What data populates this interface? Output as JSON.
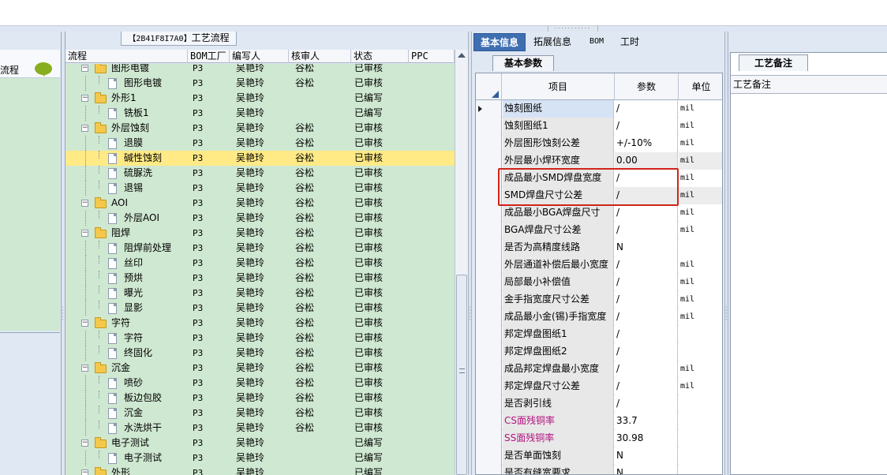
{
  "left_panel": {
    "header_label": "流程"
  },
  "process": {
    "title_code": "【2B41F8I7A0】",
    "title_text": "工艺流程",
    "columns": [
      "流程",
      "BOM工厂",
      "编写人",
      "核审人",
      "状态",
      "PPC"
    ],
    "rows": [
      {
        "name": "图形电镀",
        "level": 1,
        "bom": "P3",
        "writer": "吴艳玲",
        "reviewer": "谷松",
        "status": "已审核",
        "selected": false
      },
      {
        "name": "图形电镀",
        "level": 2,
        "bom": "P3",
        "writer": "吴艳玲",
        "reviewer": "谷松",
        "status": "已审核",
        "selected": false
      },
      {
        "name": "外形1",
        "level": 1,
        "bom": "P3",
        "writer": "吴艳玲",
        "reviewer": "",
        "status": "已编写",
        "selected": false
      },
      {
        "name": "铣板1",
        "level": 2,
        "bom": "P3",
        "writer": "吴艳玲",
        "reviewer": "",
        "status": "已编写",
        "selected": false
      },
      {
        "name": "外层蚀刻",
        "level": 1,
        "bom": "P3",
        "writer": "吴艳玲",
        "reviewer": "谷松",
        "status": "已审核",
        "selected": false
      },
      {
        "name": "退膜",
        "level": 2,
        "bom": "P3",
        "writer": "吴艳玲",
        "reviewer": "谷松",
        "status": "已审核",
        "selected": false
      },
      {
        "name": "碱性蚀刻",
        "level": 2,
        "bom": "P3",
        "writer": "吴艳玲",
        "reviewer": "谷松",
        "status": "已审核",
        "selected": true
      },
      {
        "name": "硫脲洗",
        "level": 2,
        "bom": "P3",
        "writer": "吴艳玲",
        "reviewer": "谷松",
        "status": "已审核",
        "selected": false
      },
      {
        "name": "退锡",
        "level": 2,
        "bom": "P3",
        "writer": "吴艳玲",
        "reviewer": "谷松",
        "status": "已审核",
        "selected": false
      },
      {
        "name": "AOI",
        "level": 1,
        "bom": "P3",
        "writer": "吴艳玲",
        "reviewer": "谷松",
        "status": "已审核",
        "selected": false
      },
      {
        "name": "外层AOI",
        "level": 2,
        "bom": "P3",
        "writer": "吴艳玲",
        "reviewer": "谷松",
        "status": "已审核",
        "selected": false
      },
      {
        "name": "阻焊",
        "level": 1,
        "bom": "P3",
        "writer": "吴艳玲",
        "reviewer": "谷松",
        "status": "已审核",
        "selected": false
      },
      {
        "name": "阻焊前处理",
        "level": 2,
        "bom": "P3",
        "writer": "吴艳玲",
        "reviewer": "谷松",
        "status": "已审核",
        "selected": false
      },
      {
        "name": "丝印",
        "level": 2,
        "bom": "P3",
        "writer": "吴艳玲",
        "reviewer": "谷松",
        "status": "已审核",
        "selected": false
      },
      {
        "name": "预烘",
        "level": 2,
        "bom": "P3",
        "writer": "吴艳玲",
        "reviewer": "谷松",
        "status": "已审核",
        "selected": false
      },
      {
        "name": "曝光",
        "level": 2,
        "bom": "P3",
        "writer": "吴艳玲",
        "reviewer": "谷松",
        "status": "已审核",
        "selected": false
      },
      {
        "name": "显影",
        "level": 2,
        "bom": "P3",
        "writer": "吴艳玲",
        "reviewer": "谷松",
        "status": "已审核",
        "selected": false
      },
      {
        "name": "字符",
        "level": 1,
        "bom": "P3",
        "writer": "吴艳玲",
        "reviewer": "谷松",
        "status": "已审核",
        "selected": false
      },
      {
        "name": "字符",
        "level": 2,
        "bom": "P3",
        "writer": "吴艳玲",
        "reviewer": "谷松",
        "status": "已审核",
        "selected": false
      },
      {
        "name": "终固化",
        "level": 2,
        "bom": "P3",
        "writer": "吴艳玲",
        "reviewer": "谷松",
        "status": "已审核",
        "selected": false
      },
      {
        "name": "沉金",
        "level": 1,
        "bom": "P3",
        "writer": "吴艳玲",
        "reviewer": "谷松",
        "status": "已审核",
        "selected": false
      },
      {
        "name": "喷砂",
        "level": 2,
        "bom": "P3",
        "writer": "吴艳玲",
        "reviewer": "谷松",
        "status": "已审核",
        "selected": false
      },
      {
        "name": "板边包胶",
        "level": 2,
        "bom": "P3",
        "writer": "吴艳玲",
        "reviewer": "谷松",
        "status": "已审核",
        "selected": false
      },
      {
        "name": "沉金",
        "level": 2,
        "bom": "P3",
        "writer": "吴艳玲",
        "reviewer": "谷松",
        "status": "已审核",
        "selected": false
      },
      {
        "name": "水洗烘干",
        "level": 2,
        "bom": "P3",
        "writer": "吴艳玲",
        "reviewer": "谷松",
        "status": "已审核",
        "selected": false
      },
      {
        "name": "电子测试",
        "level": 1,
        "bom": "P3",
        "writer": "吴艳玲",
        "reviewer": "",
        "status": "已编写",
        "selected": false
      },
      {
        "name": "电子测试",
        "level": 2,
        "bom": "P3",
        "writer": "吴艳玲",
        "reviewer": "",
        "status": "已编写",
        "selected": false
      },
      {
        "name": "外形",
        "level": 1,
        "bom": "P3",
        "writer": "吴艳玲",
        "reviewer": "",
        "status": "已编写",
        "selected": false
      }
    ]
  },
  "params": {
    "tabs": [
      "基本信息",
      "拓展信息",
      "BOM",
      "工时"
    ],
    "active_tab": 0,
    "subtab": "基本参数",
    "columns": [
      "项目",
      "参数",
      "单位"
    ],
    "rows": [
      {
        "item": "蚀刻图纸",
        "value": "/",
        "unit": "mil",
        "color": "",
        "current": true
      },
      {
        "item": "蚀刻图纸1",
        "value": "/",
        "unit": "mil",
        "color": ""
      },
      {
        "item": "外层图形蚀刻公差",
        "value": "+/-10%",
        "unit": "mil",
        "color": ""
      },
      {
        "item": "外层最小焊环宽度",
        "value": "0.00",
        "unit": "mil",
        "color": "",
        "grey": true
      },
      {
        "item": "成品最小SMD焊盘宽度",
        "value": "/",
        "unit": "mil",
        "color": ""
      },
      {
        "item": "SMD焊盘尺寸公差",
        "value": "/",
        "unit": "mil",
        "color": "",
        "grey": true
      },
      {
        "item": "成品最小BGA焊盘尺寸",
        "value": "/",
        "unit": "mil",
        "color": ""
      },
      {
        "item": "BGA焊盘尺寸公差",
        "value": "/",
        "unit": "mil",
        "color": ""
      },
      {
        "item": "是否为高精度线路",
        "value": "N",
        "unit": "",
        "color": ""
      },
      {
        "item": "外层通道补偿后最小宽度",
        "value": "/",
        "unit": "mil",
        "color": ""
      },
      {
        "item": "局部最小补偿值",
        "value": "/",
        "unit": "mil",
        "color": ""
      },
      {
        "item": "金手指宽度尺寸公差",
        "value": "/",
        "unit": "mil",
        "color": ""
      },
      {
        "item": "成品最小金(锡)手指宽度",
        "value": "/",
        "unit": "mil",
        "color": ""
      },
      {
        "item": "邦定焊盘图纸1",
        "value": "/",
        "unit": "",
        "color": ""
      },
      {
        "item": "邦定焊盘图纸2",
        "value": "/",
        "unit": "",
        "color": ""
      },
      {
        "item": "成品邦定焊盘最小宽度",
        "value": "/",
        "unit": "mil",
        "color": ""
      },
      {
        "item": "邦定焊盘尺寸公差",
        "value": "/",
        "unit": "mil",
        "color": ""
      },
      {
        "item": "是否剥引线",
        "value": "/",
        "unit": "",
        "color": ""
      },
      {
        "item": "CS面残铜率",
        "value": "33.7",
        "unit": "",
        "color": "magenta"
      },
      {
        "item": "SS面残铜率",
        "value": "30.98",
        "unit": "",
        "color": "magenta"
      },
      {
        "item": "是否单面蚀刻",
        "value": "N",
        "unit": "",
        "color": ""
      },
      {
        "item": "是否有缝宽要求",
        "value": "N",
        "unit": "",
        "color": ""
      }
    ]
  },
  "remarks": {
    "tab": "工艺备注",
    "column": "工艺备注"
  }
}
